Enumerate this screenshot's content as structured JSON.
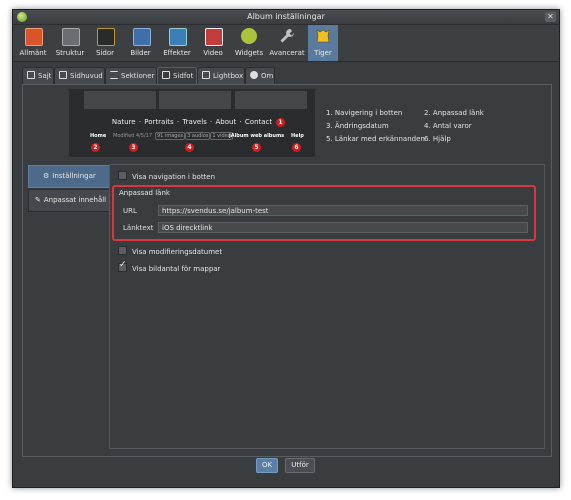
{
  "window": {
    "title": "Album inställningar"
  },
  "toolbar": {
    "items": [
      {
        "label": "Allmänt",
        "color": "#d9542a"
      },
      {
        "label": "Struktur",
        "color": "#6a6d71"
      },
      {
        "label": "Sidor",
        "color": "#b89a2e"
      },
      {
        "label": "Bilder",
        "color": "#3f6fa8"
      },
      {
        "label": "Effekter",
        "color": "#3a7fb8"
      },
      {
        "label": "Video",
        "color": "#c43b3b"
      },
      {
        "label": "Widgets",
        "color": "#a7c43a"
      },
      {
        "label": "Avancerat",
        "color": "#8a8d91"
      },
      {
        "label": "Tiger",
        "color": "#f0c020",
        "active": true
      }
    ]
  },
  "tabs": [
    {
      "label": "Sajt",
      "icon": "site-icon"
    },
    {
      "label": "Sidhuvud",
      "icon": "header-icon"
    },
    {
      "label": "Sektioner",
      "icon": "list-icon"
    },
    {
      "label": "Sidfot",
      "icon": "footer-icon",
      "active": true
    },
    {
      "label": "Lightbox",
      "icon": "lightbox-icon"
    },
    {
      "label": "Om",
      "icon": "info-icon"
    }
  ],
  "preview": {
    "nav": [
      "Nature",
      "Portraits",
      "Travels",
      "About",
      "Contact"
    ],
    "home": "Home",
    "modified": "Modified 4/5/17",
    "counts": [
      "91 images",
      "3 audios",
      "1 video"
    ],
    "web_albums": "jAlbum web albums",
    "help": "Help",
    "badges": [
      "1",
      "2",
      "3",
      "4",
      "5",
      "6"
    ]
  },
  "legend": {
    "items": [
      "1. Navigering i botten",
      "2. Anpassad länk",
      "3. Ändringsdatum",
      "4. Antal varor",
      "5. Länkar med erkännanden",
      "6. Hjälp"
    ]
  },
  "side_tabs": [
    {
      "label": "Inställningar",
      "icon": "gear-icon",
      "active": true
    },
    {
      "label": "Anpassat innehåll",
      "icon": "edit-icon"
    }
  ],
  "settings": {
    "show_nav": {
      "label": "Visa navigation i botten",
      "checked": false
    },
    "custom_link": {
      "title": "Anpassad länk",
      "url_label": "URL",
      "url_value": "https://svendus.se/jalbum-test",
      "text_label": "Länktext",
      "text_value": "iOS direcktlink"
    },
    "show_modified": {
      "label": "Visa modifieringsdatumet",
      "checked": false
    },
    "show_counts": {
      "label": "Visa bildantal för mappar",
      "checked": true
    }
  },
  "footer": {
    "ok": "OK",
    "apply": "Utför"
  }
}
